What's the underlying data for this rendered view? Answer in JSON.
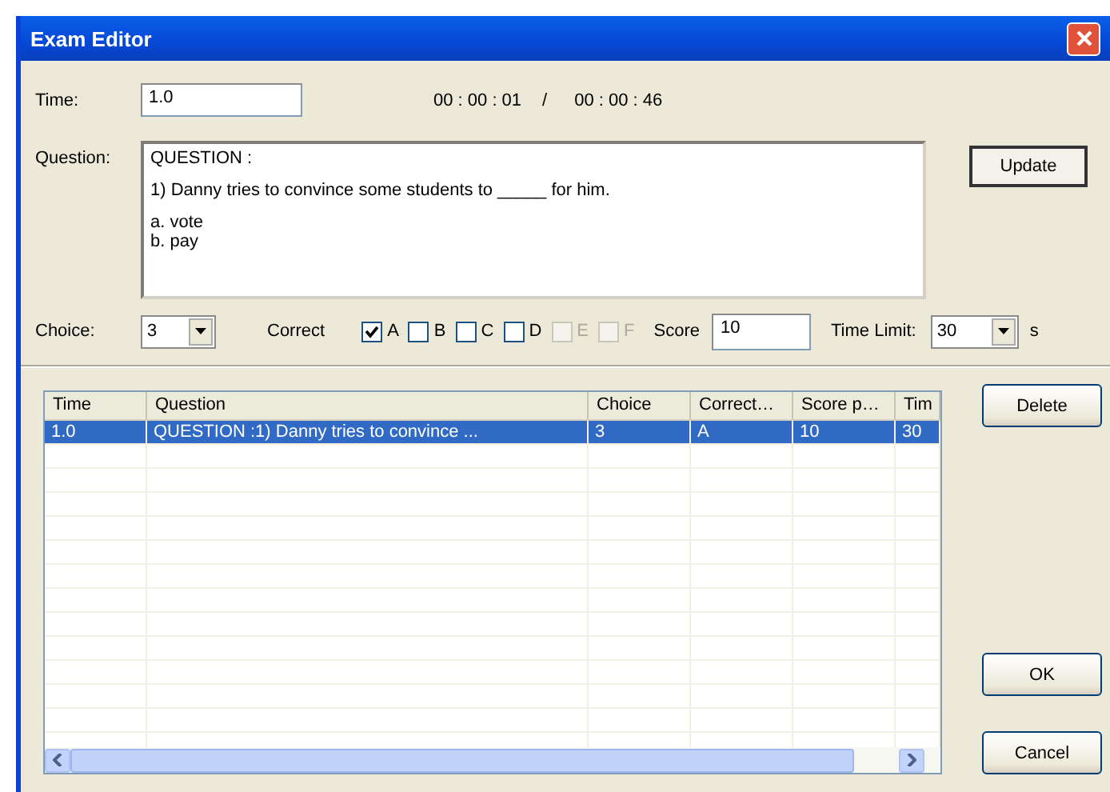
{
  "window": {
    "title": "Exam Editor"
  },
  "time": {
    "label": "Time:",
    "value": "1.0"
  },
  "timer": {
    "current": "00 : 00 : 01",
    "separator": "/",
    "total": "00 : 00 : 46"
  },
  "question": {
    "label": "Question:",
    "paragraphs": [
      [
        "QUESTION :"
      ],
      [
        "1) Danny tries to convince some students to _____ for him."
      ],
      [
        "a. vote",
        "b. pay"
      ]
    ]
  },
  "update_button": "Update",
  "choice": {
    "label": "Choice:",
    "value": "3"
  },
  "correct": {
    "label": "Correct",
    "options": [
      {
        "label": "A",
        "checked": true,
        "disabled": false
      },
      {
        "label": "B",
        "checked": false,
        "disabled": false
      },
      {
        "label": "C",
        "checked": false,
        "disabled": false
      },
      {
        "label": "D",
        "checked": false,
        "disabled": false
      },
      {
        "label": "E",
        "checked": false,
        "disabled": true
      },
      {
        "label": "F",
        "checked": false,
        "disabled": true
      }
    ]
  },
  "score": {
    "label": "Score",
    "value": "10"
  },
  "time_limit": {
    "label": "Time Limit:",
    "value": "30",
    "unit": "s"
  },
  "table": {
    "columns": [
      "Time",
      "Question",
      "Choice",
      "Correct…",
      "Score p…",
      "Tim"
    ],
    "rows": [
      {
        "cells": [
          "1.0",
          "QUESTION :1) Danny tries to convince ...",
          "3",
          "A",
          "10",
          "30"
        ],
        "selected": true
      }
    ]
  },
  "buttons": {
    "delete": "Delete",
    "ok": "OK",
    "cancel": "Cancel"
  }
}
